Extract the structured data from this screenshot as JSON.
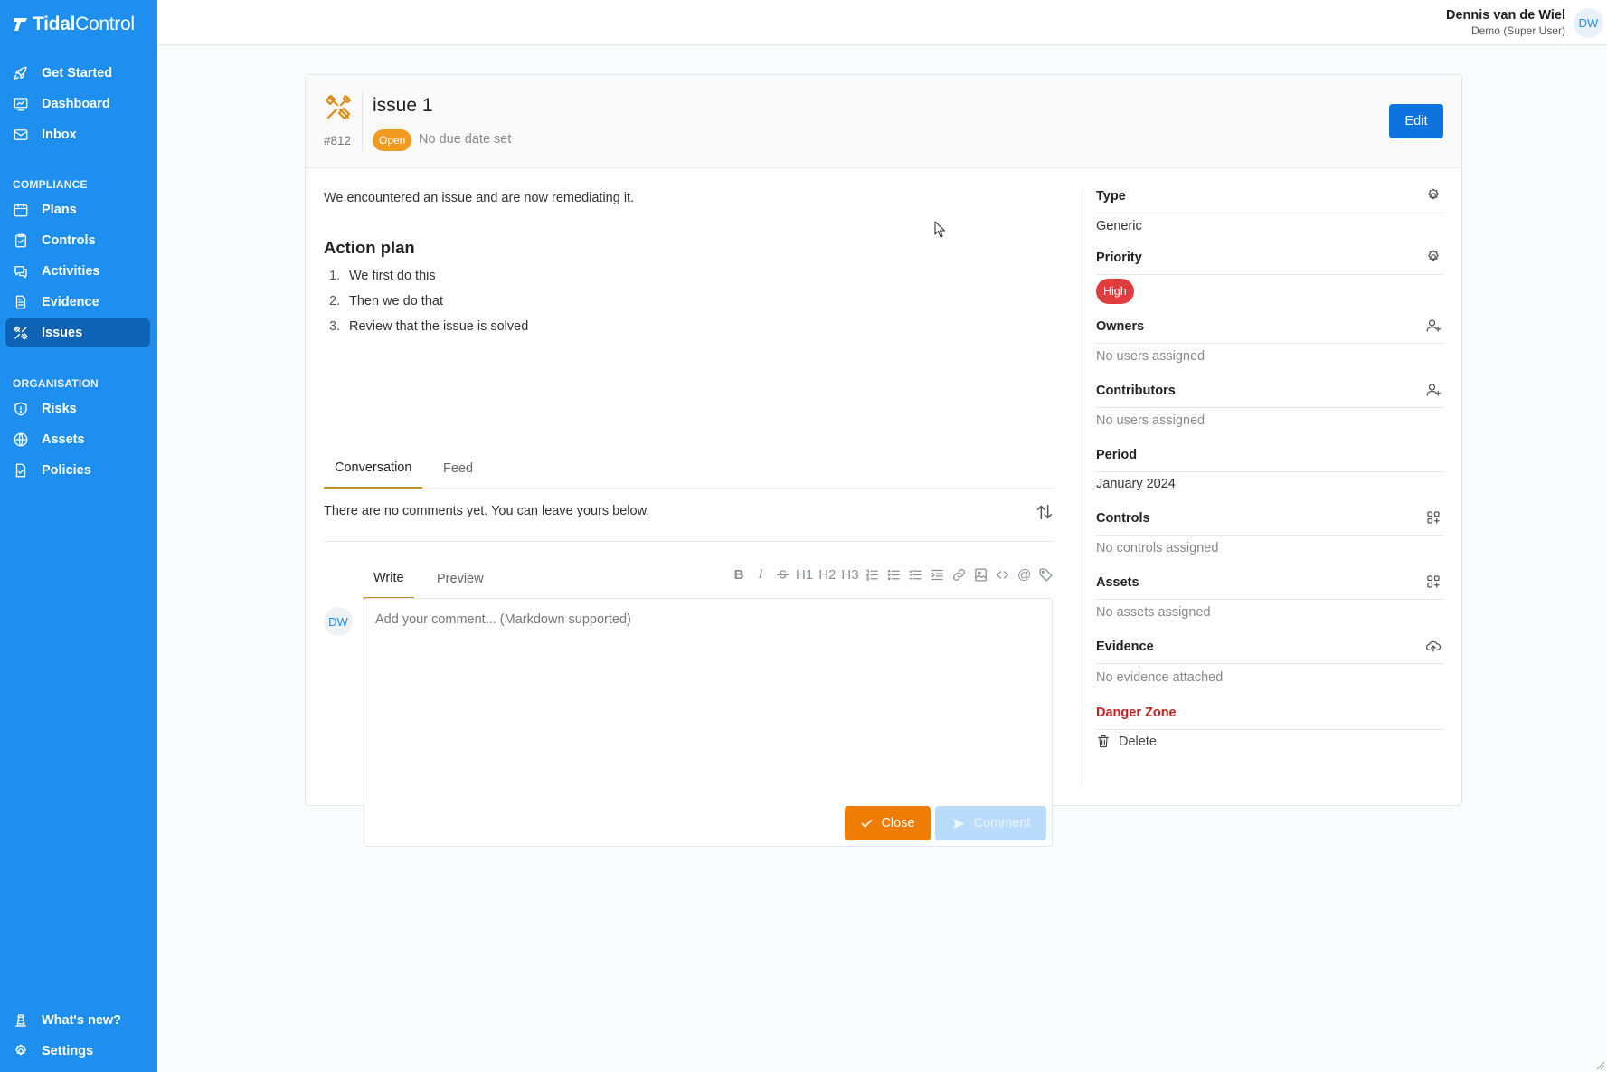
{
  "brand": {
    "name_bold": "Tidal",
    "name_light": "Control"
  },
  "nav": {
    "top": [
      {
        "label": "Get Started",
        "icon": "rocket-icon"
      },
      {
        "label": "Dashboard",
        "icon": "chart-icon"
      },
      {
        "label": "Inbox",
        "icon": "mail-icon"
      }
    ],
    "compliance_title": "COMPLIANCE",
    "compliance": [
      {
        "label": "Plans",
        "icon": "calendar-icon"
      },
      {
        "label": "Controls",
        "icon": "clipboard-check-icon"
      },
      {
        "label": "Activities",
        "icon": "chat-icon"
      },
      {
        "label": "Evidence",
        "icon": "document-icon"
      },
      {
        "label": "Issues",
        "icon": "tools-icon",
        "active": true
      }
    ],
    "organisation_title": "ORGANISATION",
    "organisation": [
      {
        "label": "Risks",
        "icon": "shield-icon"
      },
      {
        "label": "Assets",
        "icon": "globe-icon"
      },
      {
        "label": "Policies",
        "icon": "file-check-icon"
      }
    ],
    "bottom": [
      {
        "label": "What's new?",
        "icon": "lighthouse-icon"
      },
      {
        "label": "Settings",
        "icon": "gear-icon"
      }
    ]
  },
  "user": {
    "name": "Dennis van de Wiel",
    "role": "Demo (Super User)",
    "initials": "DW"
  },
  "issue": {
    "number": "#812",
    "title": "issue 1",
    "status": "Open",
    "due": "No due date set",
    "edit_label": "Edit",
    "description": "We encountered an issue and are now remediating it.",
    "action_plan_title": "Action plan",
    "action_plan": [
      {
        "num": "1.",
        "text": "We first do this"
      },
      {
        "num": "2.",
        "text": "Then we do that"
      },
      {
        "num": "3.",
        "text": "Review that the issue is solved"
      }
    ]
  },
  "conversation": {
    "tabs": [
      "Conversation",
      "Feed"
    ],
    "empty_text": "There are no comments yet. You can leave yours below.",
    "write_tabs": [
      "Write",
      "Preview"
    ],
    "toolbar": {
      "bold": "B",
      "italic": "I",
      "h1": "H1",
      "h2": "H2",
      "h3": "H3",
      "mention": "@"
    },
    "placeholder": "Add your comment... (Markdown supported)",
    "commenter_initials": "DW",
    "close_label": "Close",
    "comment_label": "Comment"
  },
  "details": {
    "type_label": "Type",
    "type_value": "Generic",
    "priority_label": "Priority",
    "priority_value": "High",
    "owners_label": "Owners",
    "owners_value": "No users assigned",
    "contributors_label": "Contributors",
    "contributors_value": "No users assigned",
    "period_label": "Period",
    "period_value": "January 2024",
    "controls_label": "Controls",
    "controls_value": "No controls assigned",
    "assets_label": "Assets",
    "assets_value": "No assets assigned",
    "evidence_label": "Evidence",
    "evidence_value": "No evidence attached",
    "danger_label": "Danger Zone",
    "delete_label": "Delete"
  },
  "colors": {
    "sidebar": "#1e8fef",
    "sidebar_active": "#0e63b5",
    "primary": "#0d73de",
    "status_open": "#f29a1f",
    "priority_high": "#e23b3b",
    "close_button": "#ef7d05",
    "danger": "#c62020"
  }
}
